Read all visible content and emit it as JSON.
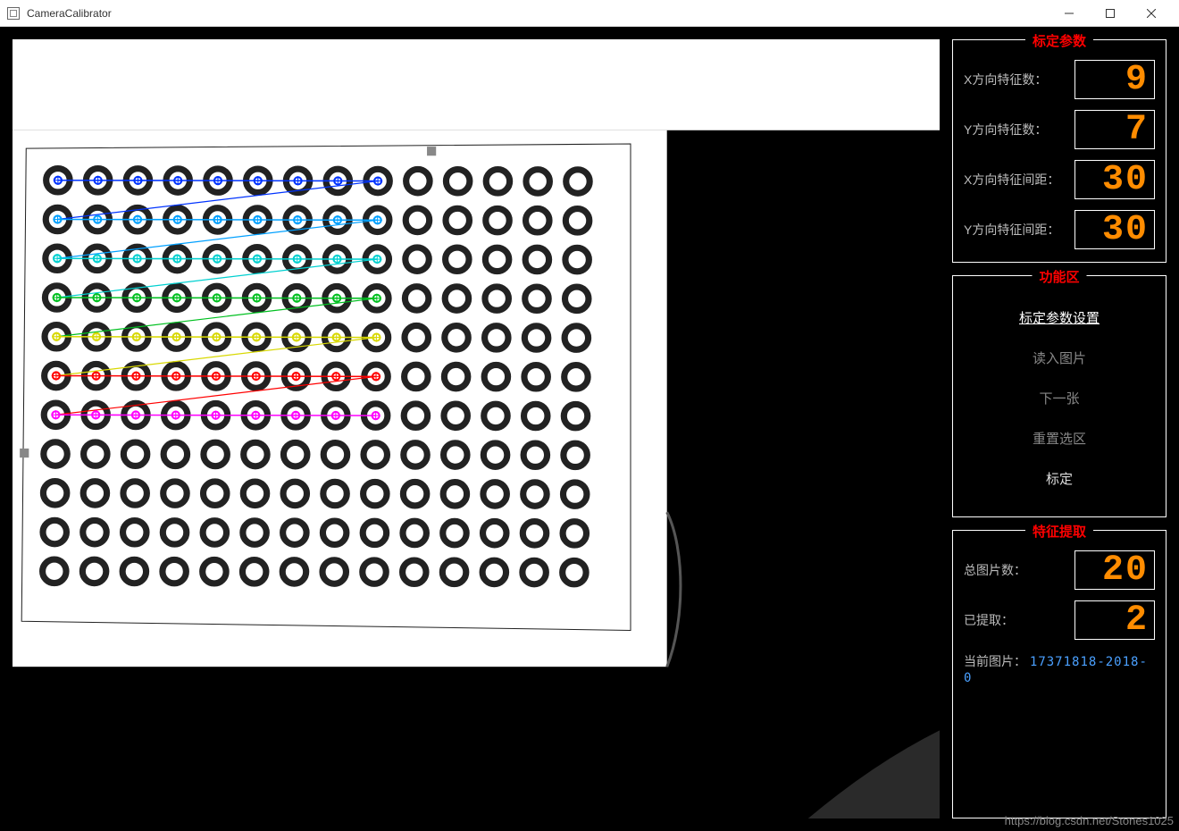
{
  "window": {
    "title": "CameraCalibrator"
  },
  "panels": {
    "calib": {
      "title": "标定参数",
      "x_count_label": "X方向特征数：",
      "x_count_value": "9",
      "y_count_label": "Y方向特征数：",
      "y_count_value": "7",
      "x_spacing_label": "X方向特征间距：",
      "x_spacing_value": "30",
      "y_spacing_label": "Y方向特征间距：",
      "y_spacing_value": "30"
    },
    "func": {
      "title": "功能区",
      "items": [
        {
          "label": "标定参数设置",
          "state": "active"
        },
        {
          "label": "读入图片",
          "state": "dim"
        },
        {
          "label": "下一张",
          "state": "dim"
        },
        {
          "label": "重置选区",
          "state": "dim"
        },
        {
          "label": "标定",
          "state": "light"
        }
      ]
    },
    "extract": {
      "title": "特征提取",
      "total_label": "总图片数：",
      "total_value": "20",
      "done_label": "已提取：",
      "done_value": "2",
      "current_label": "当前图片：",
      "current_value": "17371818-2018-0"
    }
  },
  "watermark": "https://blog.csdn.net/Stones1025",
  "calib_image": {
    "grid_cols": 14,
    "grid_rows": 11,
    "detected_cols": 9,
    "detected_rows": 7,
    "row_colors": [
      "#0033ff",
      "#00a0ff",
      "#00d0d0",
      "#00c020",
      "#d8d800",
      "#ff0000",
      "#ff00ff"
    ]
  }
}
